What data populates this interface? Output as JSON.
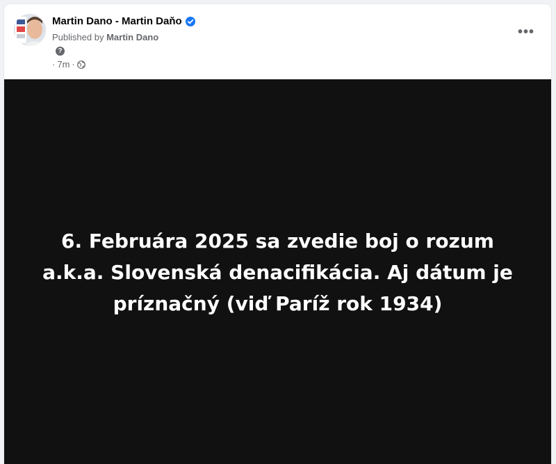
{
  "post": {
    "author_name": "Martin Dano - Martin Daňo",
    "published_prefix": "Published by",
    "published_by_name": "Martin Dano",
    "help_icon_glyph": "?",
    "time": "7m",
    "meta_separator": "·",
    "privacy_icon": "globe-icon",
    "verified_icon": "verified-badge-icon",
    "more_options_glyph": "•••",
    "image_text": "6. Februára 2025 sa zvedie boj o rozum a.k.a. Slovenská denacifikácia. Aj dátum je príznačný (viď Paríž rok 1934)"
  },
  "colors": {
    "verified_blue": "#1877f2",
    "secondary_text": "#65676b",
    "image_background": "#111111"
  }
}
